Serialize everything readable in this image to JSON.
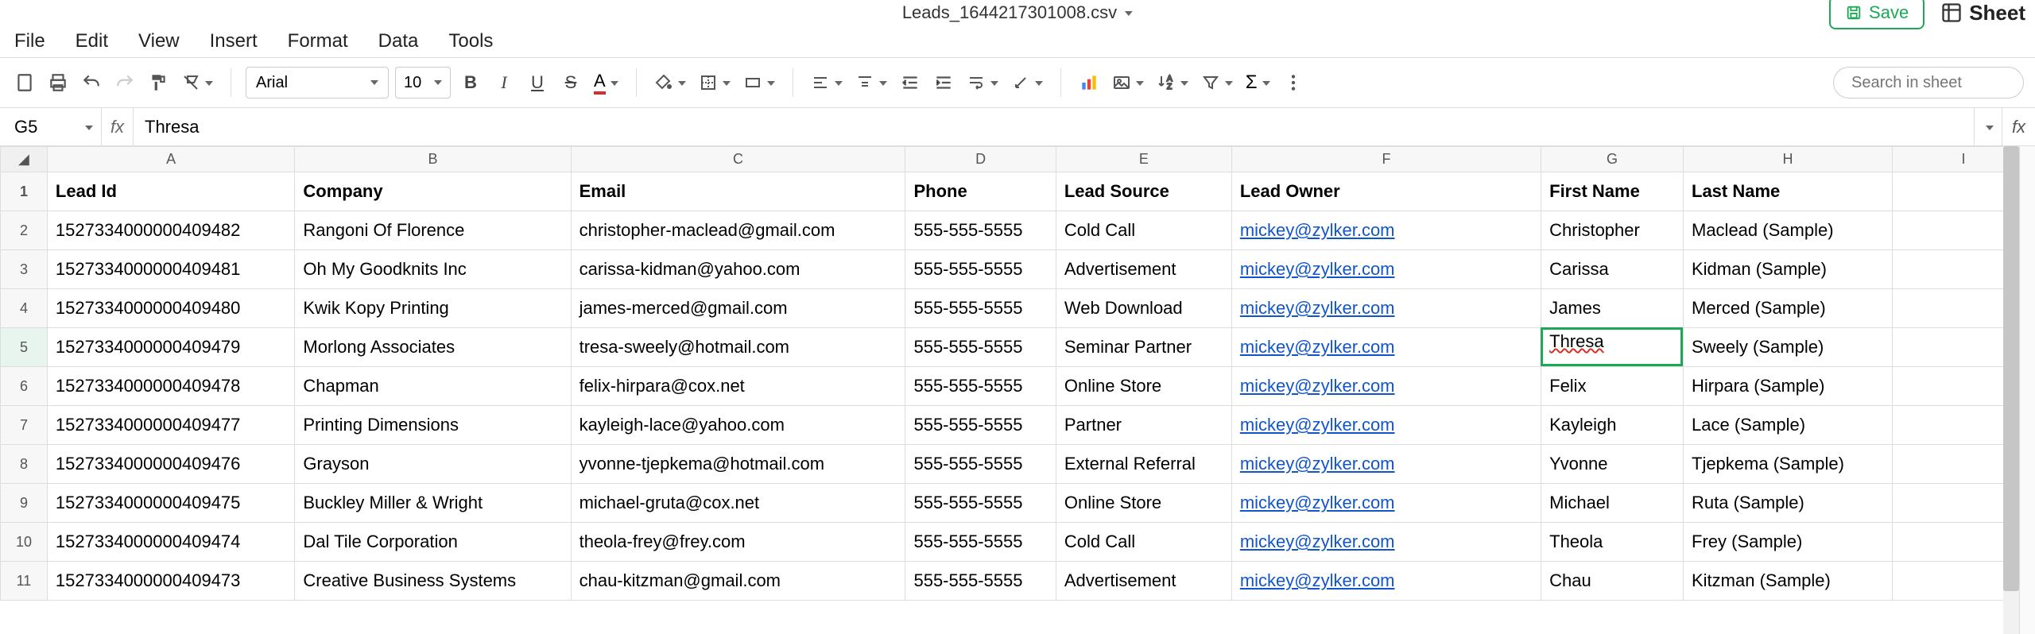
{
  "title": "Leads_1644217301008.csv",
  "buttons": {
    "save": "Save",
    "sheet": "Sheet"
  },
  "menu": {
    "file": "File",
    "edit": "Edit",
    "view": "View",
    "insert": "Insert",
    "format": "Format",
    "data": "Data",
    "tools": "Tools"
  },
  "toolbar": {
    "font": "Arial",
    "size": "10"
  },
  "search_placeholder": "Search in sheet",
  "cell_ref": "G5",
  "formula": "Thresa",
  "columns": [
    "A",
    "B",
    "C",
    "D",
    "E",
    "F",
    "G",
    "H",
    "I"
  ],
  "headers": {
    "A": "Lead Id",
    "B": "Company",
    "C": "Email",
    "D": "Phone",
    "E": "Lead Source",
    "F": "Lead Owner",
    "G": "First Name",
    "H": "Last Name"
  },
  "rows": [
    {
      "n": 2,
      "A": "1527334000000409482",
      "B": "Rangoni Of Florence",
      "C": "christopher-maclead@gmail.com",
      "D": "555-555-5555",
      "E": "Cold Call",
      "F": "mickey@zylker.com",
      "G": "Christopher",
      "H": "Maclead (Sample)"
    },
    {
      "n": 3,
      "A": "1527334000000409481",
      "B": "Oh My Goodknits Inc",
      "C": "carissa-kidman@yahoo.com",
      "D": "555-555-5555",
      "E": "Advertisement",
      "F": "mickey@zylker.com",
      "G": "Carissa",
      "H": "Kidman (Sample)"
    },
    {
      "n": 4,
      "A": "1527334000000409480",
      "B": "Kwik Kopy Printing",
      "C": "james-merced@gmail.com",
      "D": "555-555-5555",
      "E": "Web Download",
      "F": "mickey@zylker.com",
      "G": "James",
      "H": "Merced (Sample)"
    },
    {
      "n": 5,
      "A": "1527334000000409479",
      "B": "Morlong Associates",
      "C": "tresa-sweely@hotmail.com",
      "D": "555-555-5555",
      "E": "Seminar Partner",
      "F": "mickey@zylker.com",
      "G": "Thresa",
      "H": "Sweely (Sample)"
    },
    {
      "n": 6,
      "A": "1527334000000409478",
      "B": "Chapman",
      "C": "felix-hirpara@cox.net",
      "D": "555-555-5555",
      "E": "Online Store",
      "F": "mickey@zylker.com",
      "G": "Felix",
      "H": "Hirpara (Sample)"
    },
    {
      "n": 7,
      "A": "1527334000000409477",
      "B": "Printing Dimensions",
      "C": "kayleigh-lace@yahoo.com",
      "D": "555-555-5555",
      "E": "Partner",
      "F": "mickey@zylker.com",
      "G": "Kayleigh",
      "H": "Lace (Sample)"
    },
    {
      "n": 8,
      "A": "1527334000000409476",
      "B": "Grayson",
      "C": "yvonne-tjepkema@hotmail.com",
      "D": "555-555-5555",
      "E": "External Referral",
      "F": "mickey@zylker.com",
      "G": "Yvonne",
      "H": "Tjepkema (Sample)"
    },
    {
      "n": 9,
      "A": "1527334000000409475",
      "B": "Buckley Miller & Wright",
      "C": "michael-gruta@cox.net",
      "D": "555-555-5555",
      "E": "Online Store",
      "F": "mickey@zylker.com",
      "G": "Michael",
      "H": "Ruta (Sample)"
    },
    {
      "n": 10,
      "A": "1527334000000409474",
      "B": "Dal Tile Corporation",
      "C": "theola-frey@frey.com",
      "D": "555-555-5555",
      "E": "Cold Call",
      "F": "mickey@zylker.com",
      "G": "Theola",
      "H": "Frey (Sample)"
    },
    {
      "n": 11,
      "A": "1527334000000409473",
      "B": "Creative Business Systems",
      "C": "chau-kitzman@gmail.com",
      "D": "555-555-5555",
      "E": "Advertisement",
      "F": "mickey@zylker.com",
      "G": "Chau",
      "H": "Kitzman (Sample)"
    }
  ],
  "active": {
    "row": 5,
    "col": "G",
    "editing_value": "Thresa"
  }
}
